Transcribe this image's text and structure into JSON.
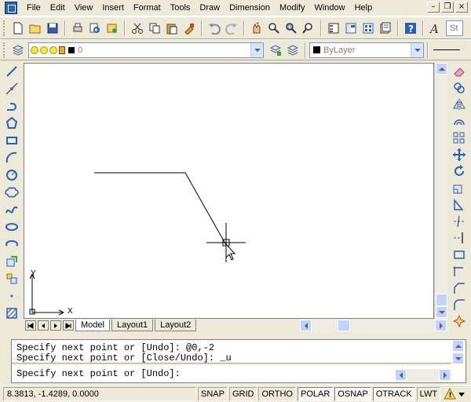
{
  "menubar": {
    "items": [
      "File",
      "Edit",
      "View",
      "Insert",
      "Format",
      "Tools",
      "Draw",
      "Dimension",
      "Modify",
      "Window",
      "Help"
    ]
  },
  "toolbar": {
    "layer_combo_value": "0",
    "color_combo_value": "ByLayer",
    "textstyle_partial": "St"
  },
  "canvas": {
    "ucs_x_label": "X",
    "ucs_y_label": "Y"
  },
  "tabs": [
    "Model",
    "Layout1",
    "Layout2"
  ],
  "command": {
    "history": [
      "Specify next point or [Undo]: @0,-2",
      "Specify next point or [Close/Undo]: _u"
    ],
    "prompt": "Specify next point or [Undo]:"
  },
  "status": {
    "coords": "8.3813, -1.4289, 0.0000",
    "buttons": [
      "SNAP",
      "GRID",
      "ORTHO",
      "POLAR",
      "OSNAP",
      "OTRACK",
      "LWT"
    ]
  },
  "colors": {
    "app_bg": "#ece9d8",
    "canvas_bg": "#ffffff",
    "scroll_accent": "#c1d3fb"
  }
}
